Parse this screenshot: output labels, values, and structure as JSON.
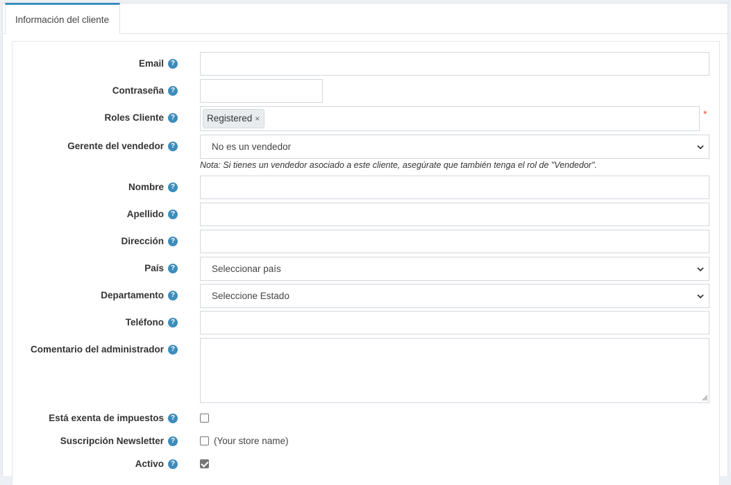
{
  "tabs": [
    {
      "label": "Información del cliente"
    }
  ],
  "form": {
    "email": {
      "label": "Email",
      "value": ""
    },
    "password": {
      "label": "Contraseña",
      "value": ""
    },
    "roles": {
      "label": "Roles Cliente",
      "tags": [
        "Registered"
      ],
      "remove_glyph": "×",
      "required_mark": "*"
    },
    "vendor": {
      "label": "Gerente del vendedor",
      "selected": "No es un vendedor",
      "note": "Nota: Si tienes un vendedor asociado a este cliente, asegúrate que también tenga el rol de \"Vendedor\"."
    },
    "first_name": {
      "label": "Nombre",
      "value": ""
    },
    "last_name": {
      "label": "Apellido",
      "value": ""
    },
    "address": {
      "label": "Dirección",
      "value": ""
    },
    "country": {
      "label": "País",
      "selected": "Seleccionar país"
    },
    "state": {
      "label": "Departamento",
      "selected": "Seleccione Estado"
    },
    "phone": {
      "label": "Teléfono",
      "value": ""
    },
    "admin_comment": {
      "label": "Comentario del administrador",
      "value": ""
    },
    "tax_exempt": {
      "label": "Está exenta de impuestos",
      "checked": false
    },
    "newsletter": {
      "label": "Suscripción Newsletter",
      "checked": false,
      "store": "(Your store name)"
    },
    "active": {
      "label": "Activo",
      "checked": true
    }
  },
  "icons": {
    "help": "question-circle-icon",
    "select_arrow": "chevron-down-icon",
    "resize": "resize-grip-icon"
  },
  "colors": {
    "accent": "#3c8dbc",
    "required": "#dd4b39"
  }
}
